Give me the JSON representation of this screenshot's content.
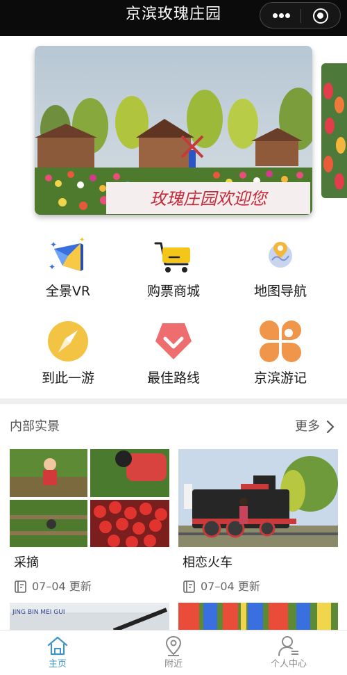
{
  "nav": {
    "title": "京滨玫瑰庄园",
    "more_icon": "more-dots-icon",
    "close_icon": "target-circle-icon"
  },
  "banner": {
    "sign_text": "玫瑰庄园欢迎您"
  },
  "grid": [
    {
      "label": "全景VR",
      "icon": "vr-cube-icon"
    },
    {
      "label": "购票商城",
      "icon": "shopping-cart-icon"
    },
    {
      "label": "地图导航",
      "icon": "map-pin-icon"
    },
    {
      "label": "到此一游",
      "icon": "compass-icon"
    },
    {
      "label": "最佳路线",
      "icon": "route-diamond-icon"
    },
    {
      "label": "京滨游记",
      "icon": "travel-notes-icon"
    }
  ],
  "section": {
    "title": "内部实景",
    "more": "更多"
  },
  "cards": [
    {
      "name": "采摘",
      "meta": "07–04 更新"
    },
    {
      "name": "相恋火车",
      "meta": "07–04 更新"
    }
  ],
  "partial_cards": [
    {
      "sign_text": "JING BIN MEI GUI"
    }
  ],
  "tabbar": {
    "items": [
      {
        "label": "主页",
        "icon": "home-icon",
        "active": true
      },
      {
        "label": "附近",
        "icon": "location-icon",
        "active": false
      },
      {
        "label": "个人中心",
        "icon": "user-icon",
        "active": false
      }
    ],
    "active_color": "#3f95c8",
    "inactive_color": "#8a8a8a"
  },
  "colors": {
    "nav_bg": "#0b0b0b",
    "vr": "#3a6fe0",
    "cart": "#f5c61a",
    "compass": "#f3c343",
    "route": "#ee6e6f",
    "notes": "#f0964a"
  }
}
